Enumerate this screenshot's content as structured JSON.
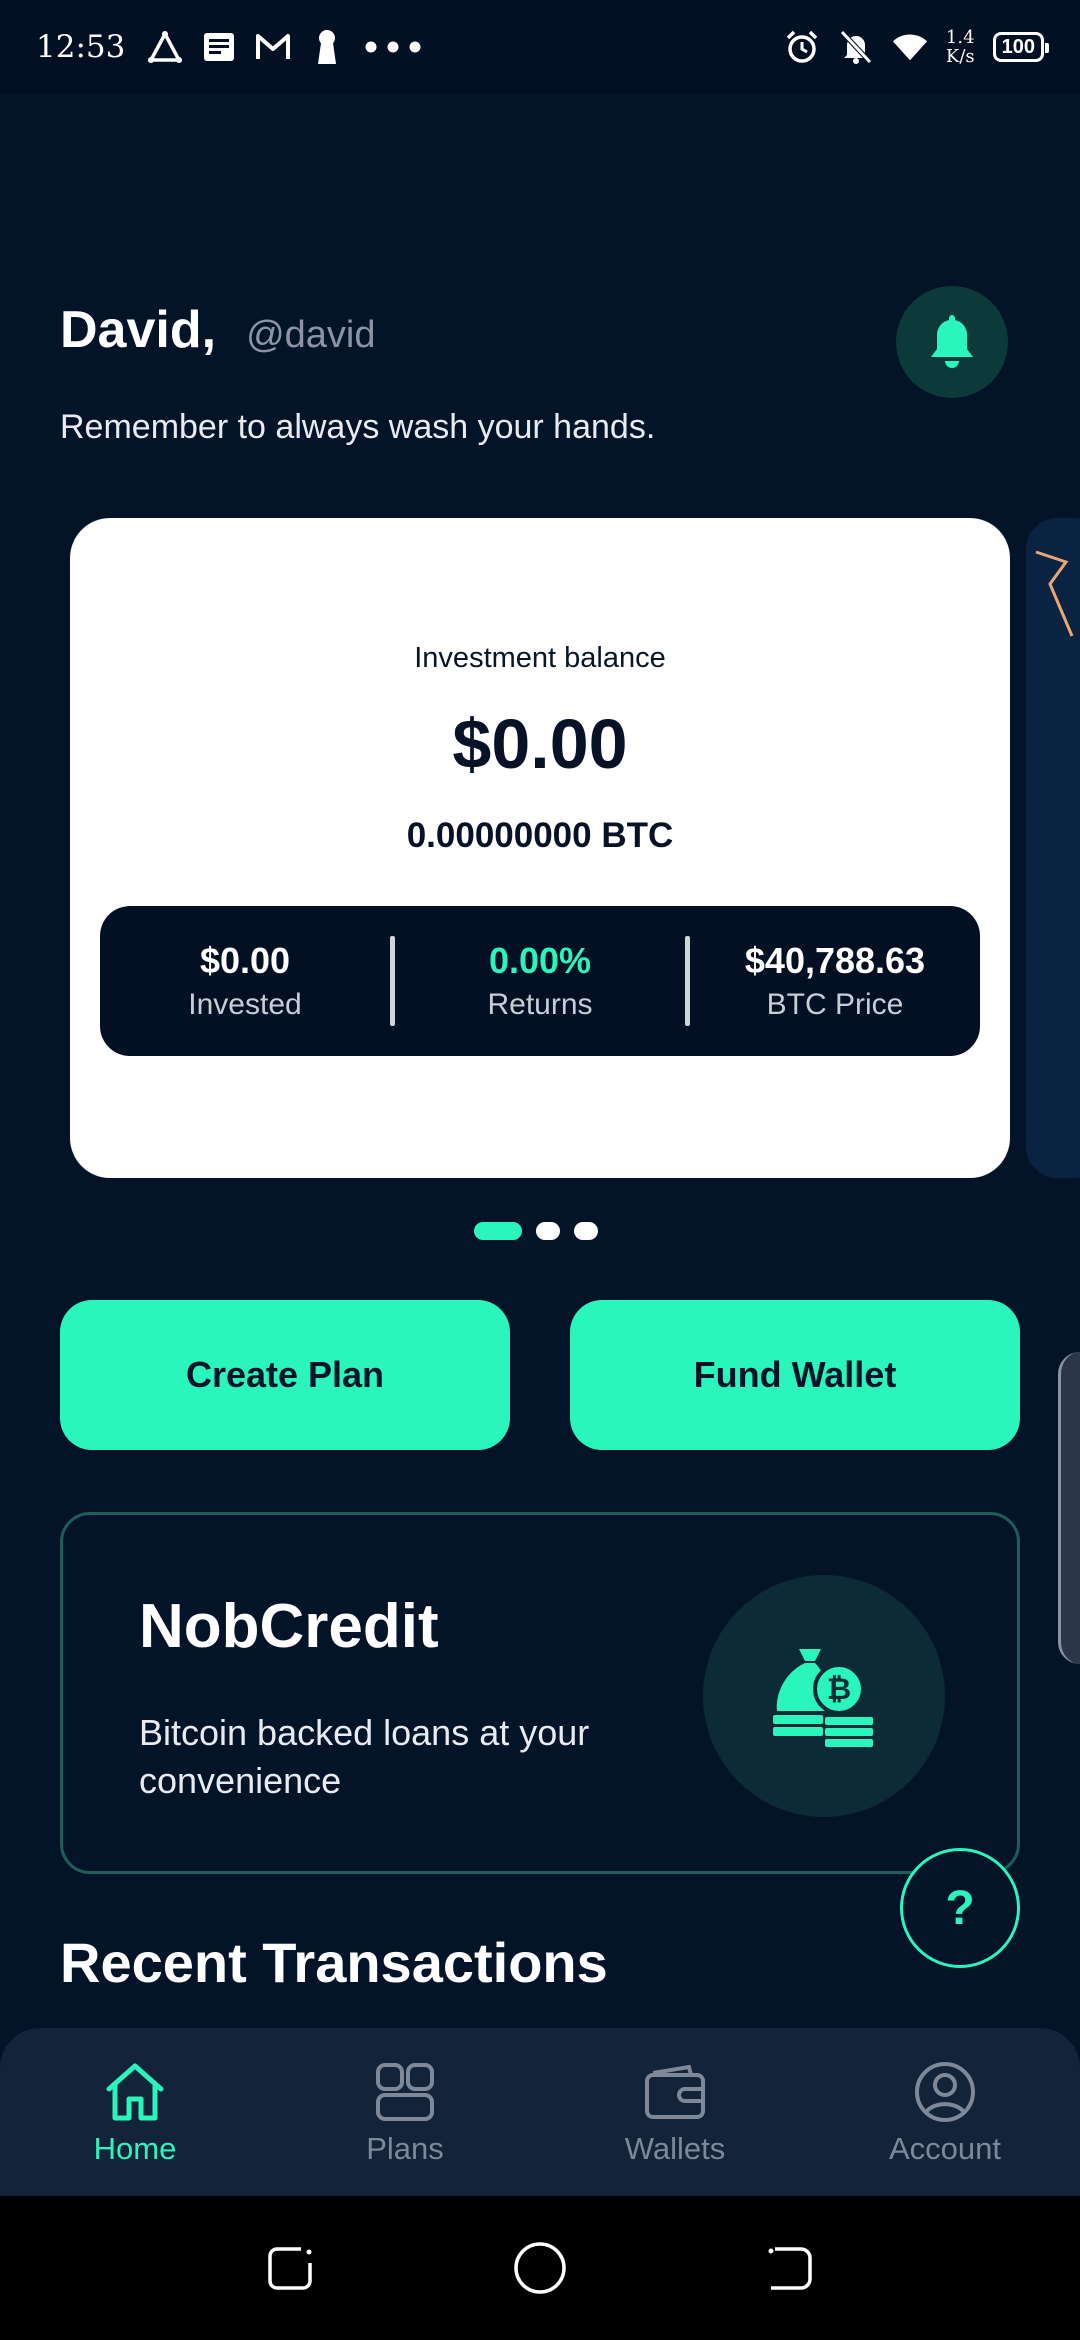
{
  "status_bar": {
    "time": "12:53",
    "left_icons": [
      "vpn-triangle-icon",
      "news-icon",
      "gmail-icon",
      "keyhole-icon",
      "more-dots-icon"
    ],
    "right_icons": [
      "alarm-icon",
      "bell-muted-icon",
      "wifi-icon"
    ],
    "net_speed_value": "1.4",
    "net_speed_unit": "K/s",
    "battery": "100"
  },
  "header": {
    "name": "David,",
    "handle": "@david",
    "message": "Remember to always wash your hands.",
    "bell_icon": "bell-icon"
  },
  "balance_card": {
    "label": "Investment balance",
    "amount": "$0.00",
    "btc": "0.00000000 BTC",
    "stats": [
      {
        "value": "$0.00",
        "label": "Invested"
      },
      {
        "value": "0.00%",
        "label": "Returns"
      },
      {
        "value": "$40,788.63",
        "label": "BTC Price"
      }
    ]
  },
  "carousel": {
    "count": 3,
    "active": 0
  },
  "actions": {
    "create_plan": "Create Plan",
    "fund_wallet": "Fund Wallet"
  },
  "nobcredit": {
    "title": "NobCredit",
    "description": "Bitcoin backed loans at your convenience",
    "icon": "bitcoin-money-bag-icon"
  },
  "help": {
    "label": "?"
  },
  "recent": {
    "title": "Recent Transactions"
  },
  "bottom_nav": {
    "items": [
      {
        "label": "Home",
        "icon": "home-icon",
        "active": true
      },
      {
        "label": "Plans",
        "icon": "plans-icon",
        "active": false
      },
      {
        "label": "Wallets",
        "icon": "wallet-icon",
        "active": false
      },
      {
        "label": "Account",
        "icon": "account-icon",
        "active": false
      }
    ]
  },
  "colors": {
    "background": "#041428",
    "accent": "#2af5bc",
    "card": "#ffffff",
    "nav": "#12233a"
  }
}
